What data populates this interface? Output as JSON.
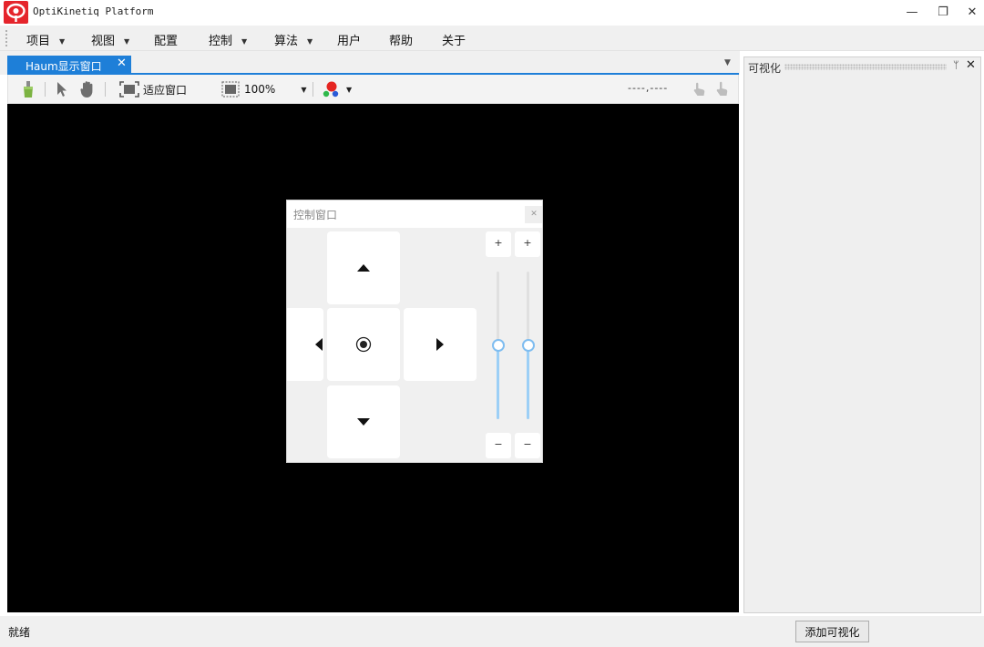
{
  "window": {
    "title": "OptiKinetiq Platform",
    "minimize_glyph": "—",
    "restore_glyph": "❐",
    "close_glyph": "✕"
  },
  "menu": {
    "items": [
      {
        "label": "项目",
        "has_dropdown": true
      },
      {
        "label": "视图",
        "has_dropdown": true
      },
      {
        "label": "配置",
        "has_dropdown": false
      },
      {
        "label": "控制",
        "has_dropdown": true
      },
      {
        "label": "算法",
        "has_dropdown": true
      },
      {
        "label": "用户",
        "has_dropdown": false
      },
      {
        "label": "帮助",
        "has_dropdown": false
      },
      {
        "label": "关于",
        "has_dropdown": false
      }
    ]
  },
  "document_tab": {
    "label": "Haum显示窗口",
    "close_glyph": "✕"
  },
  "toolbar": {
    "fit_window_label": "适应窗口",
    "zoom_level": "100%",
    "coordinate_readout": "----,----",
    "icons": [
      "brush-icon",
      "pointer-icon",
      "hand-icon",
      "fit-window-icon",
      "zoom-icon",
      "color-dots-icon",
      "gesture-left-icon",
      "gesture-right-icon"
    ]
  },
  "control_window": {
    "title": "控制窗口",
    "close_glyph": "✕",
    "pad_icons": [
      "arrow-up-icon",
      "arrow-left-icon",
      "center-target-icon",
      "arrow-right-icon",
      "arrow-down-icon"
    ],
    "plus_label": "+",
    "minus_label": "−",
    "slider_1_fraction": 0.5,
    "slider_2_fraction": 0.5
  },
  "dock_panel": {
    "title": "可视化",
    "pin_glyph": "ᛘ",
    "close_glyph": "✕"
  },
  "status_bar": {
    "status_text": "就绪",
    "add_visualization_button": "添加可视化"
  },
  "colors": {
    "accent_blue": "#1e7fd8",
    "logo_red": "#e5242b",
    "slider_blue": "#9ccff6",
    "viewport_bg": "#000000"
  }
}
